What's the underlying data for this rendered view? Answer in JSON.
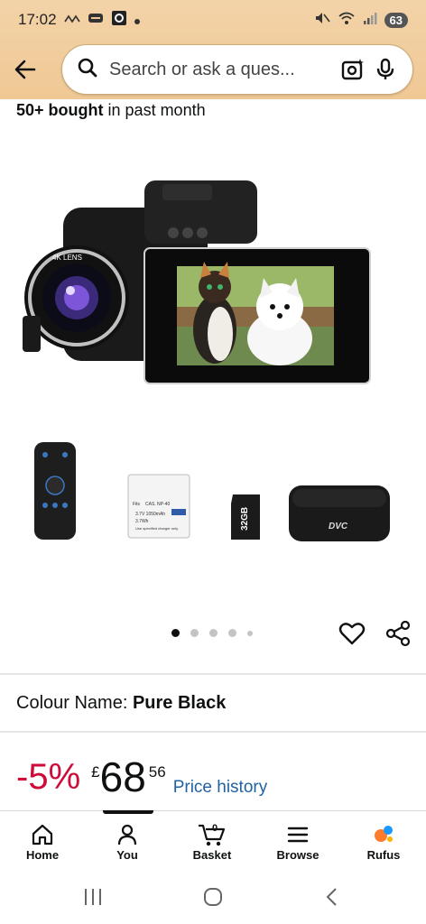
{
  "status_bar": {
    "time": "17:02",
    "battery": "63",
    "icons_left": [
      "missed-call-icon",
      "voicemail-icon",
      "app-icon",
      "dot-icon"
    ],
    "icons_right": [
      "mute-icon",
      "wifi-icon",
      "signal-icon"
    ]
  },
  "search": {
    "placeholder": "Search or ask a ques..."
  },
  "product": {
    "bought_count": "50+ bought",
    "bought_suffix": "in past month",
    "gallery_count": 5,
    "gallery_active_index": 0,
    "camera_badge": "4K LENS",
    "accessories": {
      "battery_label": "CAS. NP-40",
      "battery_line1": "3.7V  1050mAh",
      "battery_line2": "3.7Wh",
      "battery_line3": "Use specified charger only.",
      "battery_fits": "Fits",
      "sd_label": "32GB",
      "bag_label": "DVC"
    },
    "colour_label": "Colour Name:",
    "colour_value": "Pure Black",
    "discount": "-5%",
    "currency": "£",
    "price_whole": "68",
    "price_fraction": "56",
    "price_history": "Price history"
  },
  "tabs": [
    {
      "label": "Home",
      "icon": "home-icon"
    },
    {
      "label": "You",
      "icon": "person-icon",
      "active": true
    },
    {
      "label": "Basket",
      "icon": "basket-icon",
      "badge": "0"
    },
    {
      "label": "Browse",
      "icon": "menu-icon"
    },
    {
      "label": "Rufus",
      "icon": "rufus-icon"
    }
  ],
  "colors": {
    "header_bg": "#f0c894",
    "discount": "#cc0c39",
    "link": "#2162a1",
    "rufus_orange": "#ff7b2c",
    "rufus_blue": "#1a98ff"
  }
}
